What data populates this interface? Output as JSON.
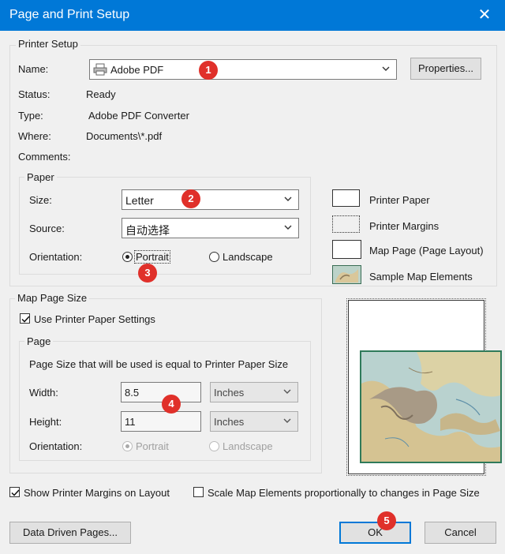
{
  "window": {
    "title": "Page and Print Setup",
    "close_glyph": "✕"
  },
  "printer_setup": {
    "group_label": "Printer Setup",
    "name_label": "Name:",
    "name_value": "Adobe PDF",
    "properties_button": "Properties...",
    "status_label": "Status:",
    "status_value": "Ready",
    "type_label": "Type:",
    "type_value": "Adobe PDF Converter",
    "where_label": "Where:",
    "where_value": "Documents\\*.pdf",
    "comments_label": "Comments:",
    "paper": {
      "group_label": "Paper",
      "size_label": "Size:",
      "size_value": "Letter",
      "source_label": "Source:",
      "source_value": "自动选择",
      "orientation_label": "Orientation:",
      "portrait_label": "Portrait",
      "landscape_label": "Landscape",
      "selected": "Portrait"
    }
  },
  "legend": {
    "printer_paper": "Printer Paper",
    "printer_margins": "Printer Margins",
    "map_page": "Map Page (Page Layout)",
    "sample_map": "Sample Map Elements"
  },
  "map_page_size": {
    "group_label": "Map Page Size",
    "use_printer_settings_label": "Use Printer Paper Settings",
    "use_printer_settings_checked": true,
    "page": {
      "group_label": "Page",
      "info_text": "Page Size that will be used is equal to Printer Paper Size",
      "width_label": "Width:",
      "width_value": "8.5",
      "width_unit": "Inches",
      "height_label": "Height:",
      "height_value": "11",
      "height_unit": "Inches",
      "orientation_label": "Orientation:",
      "portrait_label": "Portrait",
      "landscape_label": "Landscape"
    }
  },
  "bottom": {
    "show_margins_label": "Show Printer Margins on Layout",
    "show_margins_checked": true,
    "scale_elements_label": "Scale Map Elements proportionally to changes in Page Size",
    "scale_elements_checked": false,
    "data_driven_button": "Data Driven Pages...",
    "ok_button": "OK",
    "cancel_button": "Cancel"
  },
  "badges": [
    "1",
    "2",
    "3",
    "4",
    "5"
  ],
  "colors": {
    "titlebar": "#0078d7",
    "badge": "#e0302a",
    "map_border": "#2f7a5a"
  }
}
